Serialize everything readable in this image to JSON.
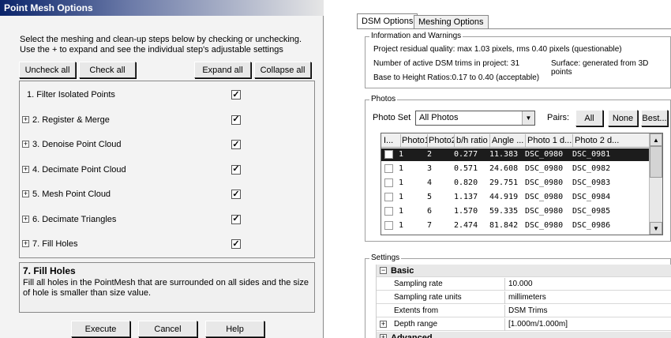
{
  "left": {
    "title": "Point Mesh Options",
    "description": "Select the meshing and clean-up steps below by checking or unchecking. Use the + to expand and see the individual step's adjustable settings",
    "buttons": {
      "uncheck_all": "Uncheck all",
      "check_all": "Check all",
      "expand_all": "Expand all",
      "collapse_all": "Collapse all"
    },
    "steps": [
      {
        "label": "1. Filter Isolated Points",
        "checked": "✓",
        "expandable": false
      },
      {
        "label": "2. Register & Merge",
        "checked": "✓",
        "expandable": true
      },
      {
        "label": "3. Denoise Point Cloud",
        "checked": "✓",
        "expandable": true
      },
      {
        "label": "4. Decimate Point Cloud",
        "checked": "✓",
        "expandable": true
      },
      {
        "label": "5. Mesh Point Cloud",
        "checked": "✓",
        "expandable": true
      },
      {
        "label": "6. Decimate Triangles",
        "checked": "✓",
        "expandable": true
      },
      {
        "label": "7. Fill Holes",
        "checked": "✓",
        "expandable": true
      }
    ],
    "info": {
      "title": "7. Fill Holes",
      "text": "Fill all holes in the PointMesh that are surrounded on all sides and the size of hole is smaller than size value."
    },
    "footer": {
      "execute": "Execute",
      "cancel": "Cancel",
      "help": "Help"
    },
    "expand_glyph": "+"
  },
  "right": {
    "tabs": [
      "DSM Options",
      "Meshing Options"
    ],
    "info_group": {
      "label": "Information and Warnings",
      "line1": "Project residual quality: max 1.03 pixels, rms 0.40 pixels (questionable)",
      "line2a": "Number of active DSM trims in project: 31",
      "line2b": "Surface: generated from 3D points",
      "line3": "Base to Height Ratios:0.17 to 0.40 (acceptable)"
    },
    "photos_group": {
      "label": "Photos",
      "photo_set_label": "Photo Set",
      "photo_set_value": "All Photos",
      "pairs_label": "Pairs:",
      "all_button": "All",
      "none_button": "None",
      "best_button": "Best...",
      "columns": [
        "I...",
        "Photo1",
        "Photo2",
        "b/h ratio",
        "Angle ...",
        "Photo 1 d...",
        "Photo 2 d..."
      ],
      "rows": [
        [
          "1",
          "2",
          "0.277",
          "11.383",
          "DSC_0980",
          "DSC_0981"
        ],
        [
          "1",
          "3",
          "0.571",
          "24.608",
          "DSC_0980",
          "DSC_0982"
        ],
        [
          "1",
          "4",
          "0.820",
          "29.751",
          "DSC_0980",
          "DSC_0983"
        ],
        [
          "1",
          "5",
          "1.137",
          "44.919",
          "DSC_0980",
          "DSC_0984"
        ],
        [
          "1",
          "6",
          "1.570",
          "59.335",
          "DSC_0980",
          "DSC_0985"
        ],
        [
          "1",
          "7",
          "2.474",
          "81.842",
          "DSC_0980",
          "DSC_0986"
        ]
      ]
    },
    "settings_group": {
      "label": "Settings",
      "basic_label": "Basic",
      "sampling_rate_label": "Sampling rate",
      "sampling_rate_value": "10.000",
      "sampling_units_label": "Sampling rate units",
      "sampling_units_value": "millimeters",
      "extents_label": "Extents from",
      "extents_value": "DSM Trims",
      "depth_label": "Depth range",
      "depth_value": "[1.000m/1.000m]",
      "advanced_label": "Advanced",
      "collapse_glyph": "−",
      "expand_glyph": "+"
    }
  },
  "colors": {
    "titlebar_start": "#0a246a",
    "titlebar_end": "#e6e6e6",
    "selected_row": "#1c1c1c",
    "info_panel": "#f0f0f0"
  }
}
